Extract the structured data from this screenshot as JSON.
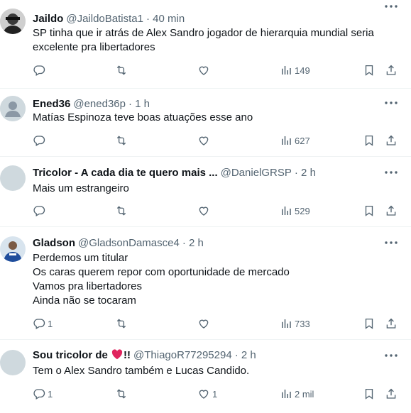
{
  "tweets": [
    {
      "name": "Jaildo",
      "handle": "@JaildoBatista1",
      "time": "· 40 min",
      "lines": [
        "SP tinha que ir atrás de Alex Sandro jogador de hierarquia mundial seria",
        "excelente pra libertadores"
      ],
      "replies": "",
      "retweets": "",
      "likes": "",
      "views": "149"
    },
    {
      "name": "Ened36",
      "handle": "@ened36p",
      "time": "· 1 h",
      "lines": [
        "Matías Espinoza teve boas atuações esse ano"
      ],
      "replies": "",
      "retweets": "",
      "likes": "",
      "views": "627"
    },
    {
      "name": "Tricolor - A cada dia te quero mais ...",
      "handle": "@DanielGRSP",
      "time": "· 2 h",
      "lines": [
        "Mais um estrangeiro"
      ],
      "replies": "",
      "retweets": "",
      "likes": "",
      "views": "529"
    },
    {
      "name": "Gladson",
      "handle": "@GladsonDamasce4",
      "time": "· 2 h",
      "lines": [
        "Perdemos um titular",
        "Os caras querem repor com oportunidade de mercado",
        "Vamos pra libertadores",
        "Ainda não se tocaram"
      ],
      "replies": "1",
      "retweets": "",
      "likes": "",
      "views": "733"
    },
    {
      "name_before": "Sou tricolor de",
      "name_after": "!!",
      "handle": "@ThiagoR77295294",
      "time": "· 2 h",
      "lines": [
        "Tem o Alex Sandro também e Lucas Candido."
      ],
      "replies": "1",
      "retweets": "",
      "likes": "1",
      "views": "2 mil"
    }
  ],
  "icons": {
    "reply": "reply-icon",
    "retweet": "retweet-icon",
    "like": "heart-icon",
    "views": "views-icon",
    "bookmark": "bookmark-icon",
    "share": "share-icon",
    "more": "more-icon",
    "heart_emoji_color": "#e0245e"
  }
}
